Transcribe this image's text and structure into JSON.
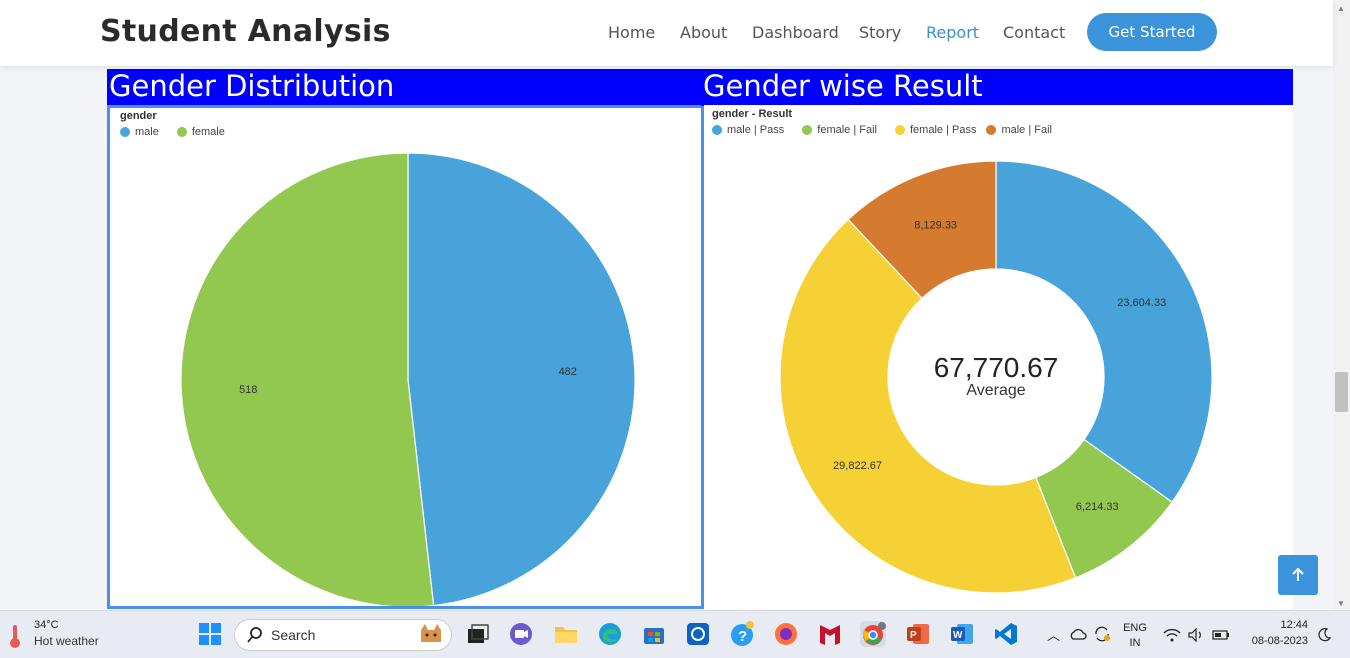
{
  "navbar": {
    "brand": "Student Analysis",
    "links": [
      "Home",
      "About",
      "Dashboard",
      "Story",
      "Report",
      "Contact"
    ],
    "active": "Report",
    "cta": "Get Started"
  },
  "left_panel": {
    "title": "Gender Distribution",
    "legend_title": "gender",
    "legend": [
      {
        "label": "male",
        "color": "#47a3d9"
      },
      {
        "label": "female",
        "color": "#93c850"
      }
    ]
  },
  "right_panel": {
    "title": "Gender wise Result",
    "legend_title": "gender - Result",
    "legend": [
      {
        "label": "male | Pass",
        "color": "#47a3d9"
      },
      {
        "label": "female | Fail",
        "color": "#93c850"
      },
      {
        "label": "female | Pass",
        "color": "#f5d136"
      },
      {
        "label": "male | Fail",
        "color": "#d47b30"
      }
    ],
    "center_value": "67,770.67",
    "center_label": "Average"
  },
  "chart_data": [
    {
      "type": "pie",
      "title": "Gender Distribution",
      "categories": [
        "male",
        "female"
      ],
      "values": [
        482,
        518
      ],
      "labels": [
        "482",
        "518"
      ],
      "colors": [
        "#47a3d9",
        "#93c850"
      ]
    },
    {
      "type": "pie",
      "title": "Gender wise Result",
      "categories": [
        "male | Pass",
        "female | Fail",
        "female | Pass",
        "male | Fail"
      ],
      "values": [
        23604.33,
        6214.33,
        29822.67,
        8129.33
      ],
      "labels": [
        "23,604.33",
        "6,214.33",
        "29,822.67",
        "8,129.33"
      ],
      "colors": [
        "#47a3d9",
        "#93c850",
        "#f5d136",
        "#d47b30"
      ],
      "donut": true
    }
  ],
  "taskbar": {
    "temperature": "34°C",
    "weather": "Hot weather",
    "search_placeholder": "Search",
    "lang_top": "ENG",
    "lang_bottom": "IN",
    "time": "12:44",
    "date": "08-08-2023"
  }
}
